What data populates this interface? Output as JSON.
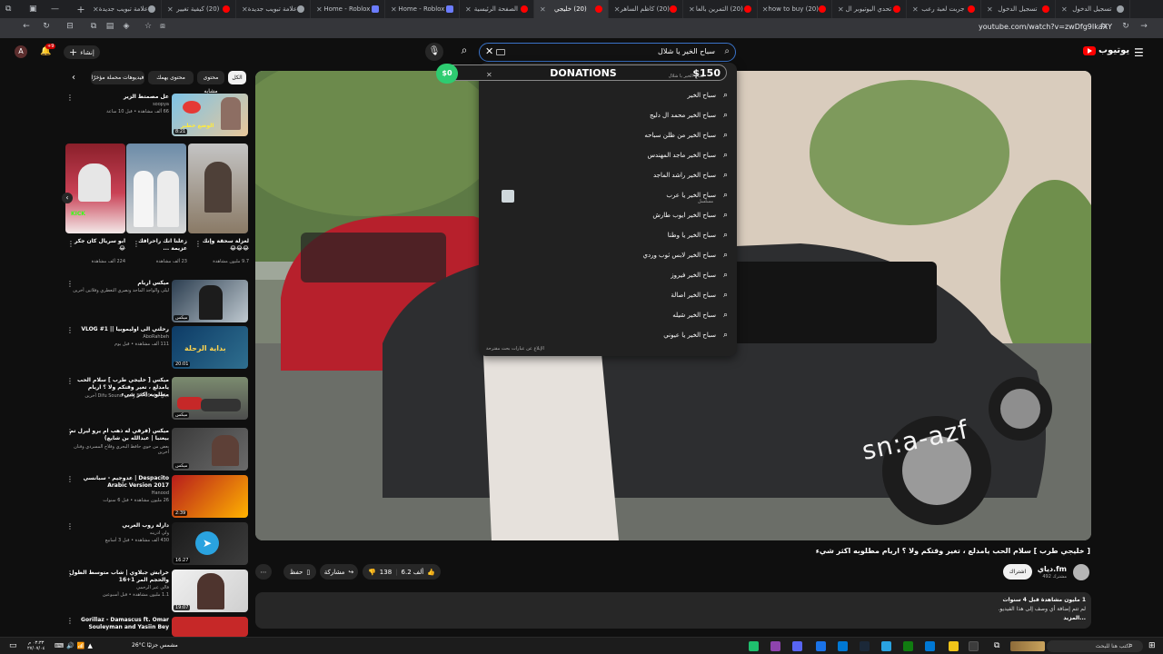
{
  "browser": {
    "tabs": [
      {
        "title": "تسجيل الدخول",
        "favicon": "profile-icon"
      },
      {
        "title": "تسجيل الدخول",
        "favicon": "youtube-icon"
      },
      {
        "title": "جربت لعبة رعب",
        "favicon": "youtube-icon"
      },
      {
        "title": "تحدي اليوتيوبر ال",
        "favicon": "youtube-icon"
      },
      {
        "title": "(20) how to buy",
        "favicon": "youtube-icon"
      },
      {
        "title": "(20) التمرين بالعا",
        "favicon": "youtube-icon"
      },
      {
        "title": "(20) كاظم الساهر",
        "favicon": "youtube-icon"
      },
      {
        "title": "(20) خليجي",
        "favicon": "youtube-icon"
      },
      {
        "title": "الصفحة الرئيسية",
        "favicon": "youtube-icon"
      },
      {
        "title": "Home - Roblox",
        "favicon": "roblox-icon"
      },
      {
        "title": "Home - Roblox",
        "favicon": "roblox-icon"
      },
      {
        "title": "علامة تبويب جديدة",
        "favicon": "chrome-icon"
      },
      {
        "title": "(20) كيفية تغيير",
        "favicon": "youtube-icon"
      },
      {
        "title": "علامة تبويب جديدة",
        "favicon": "chrome-icon"
      }
    ],
    "url": "youtube.com/watch?v=zwDfg9IkaXY"
  },
  "youtube": {
    "logo_text": "يوتيوب",
    "avatar_letter": "A",
    "bell_badge": "+9",
    "create_label": "إنشاء",
    "search_query": "سباح الخير يا شلال",
    "suggestions": [
      "سباح الخير يا شلال",
      "سباح الخير",
      "سباح الخير محمد ال دليج",
      "سباح الخير من ظلن سباحه",
      "سباح الخير ماجد المهندس",
      "سباح الخير راشد الماجد",
      "سباح الخير يا عرب",
      "سباح الخير ايوب طارش",
      "سباح الخير يا وطنا",
      "سباح الخير لابس ثوب وردي",
      "سباح الخير فيروز",
      "سباح الخير اصالة",
      "سباح الخير شيله",
      "سباح الخير يا عيوني"
    ],
    "suggestion_sub": "مسلسل",
    "report_text": "الإبلاغ عن عبارات بحث مقترحة",
    "donation": {
      "title": "DONATIONS",
      "left": "$0",
      "right": "$150"
    }
  },
  "video": {
    "watermark": "sn:a-azf",
    "title": "[ خليجي طرب ] سلام الحب يامدلع ، تغير وقتكم ولا ؟ اريام مطلوبه اكثر شيء",
    "channel": "دياي.fm",
    "subs": "492 مشترك",
    "subscribe_label": "اشتراك",
    "likes": "6.2 ألف",
    "dislikes": "138",
    "share_label": "مشاركة",
    "save_label": "حفظ",
    "desc_line1": "1 مليون مشاهدة  قبل 4 سنوات",
    "desc_line2": "لم تتم إضافة أي وصف إلى هذا الفيديو.",
    "desc_more": "...المزيد"
  },
  "sidebar": {
    "chips": [
      "الكل",
      "محتوى مشابه",
      "محتوى يهمك",
      "فيديوهات محملة مؤخرًا"
    ],
    "top_rec": {
      "title": "عل مصمتط الزير",
      "channel": "soopya",
      "views": "66 ألف مشاهدة • قبل 10 ساعة",
      "duration": "8:21",
      "thumb_text": "الوضع خطير"
    },
    "shorts": [
      {
        "title": "ابو سريال كان جكر 😂",
        "views": "224 ألف مشاهدة"
      },
      {
        "title": "زعلنا انك راحرافك عزيمة ...",
        "views": "23 ألف مشاهدة"
      },
      {
        "title": "لعزلة سحقة وإنك 😂😂😂",
        "views": "9.7 مليون مشاهدة"
      }
    ],
    "recs": [
      {
        "title": "ميكس اريام",
        "channel": "ليلى والواجد الماجد ونصري التعطري وفلاتين أخرين",
        "views": "",
        "duration": "ميكس"
      },
      {
        "title": "رحلتي الى اوليموبيا || VLOG #1",
        "channel": "AboRahbeh",
        "views": "111 ألف مشاهدة • قبل يوم",
        "duration": "20:01"
      },
      {
        "title": "ميكس [ خليجي طرب ] سلام الحب يامدلع ، تغير وقتكم ولا ؟ اريام مطلوبه اكثر شيء",
        "channel": "دياي ترك 66 FM والتين Difu Sound أخرين",
        "views": "",
        "duration": "ميكس"
      },
      {
        "title": "ميكس (فرقي له ذهب ام يرو ليرل تم بيعتبا | عبدالله بن شايع)",
        "channel": "بعض من خوي حافظ البحري وفلاح المسردي وفنان أخرين",
        "views": "",
        "duration": "ميكس"
      },
      {
        "title": "Despacito | عدوجيم - سبانسي Arabic Version 2017",
        "channel": "Hanood",
        "views": "26 مليون مشاهدة • قبل 6 سنوات",
        "duration": "2:39"
      },
      {
        "title": "دارلة روب العربي",
        "channel": "ولي ادرينه",
        "views": "430 ألف مشاهدة • قبل 3 أسابيع",
        "duration": "16:27"
      },
      {
        "title": "خرابش جبلاوي | شاب متوسط الطول والحجم المر 1+16",
        "channel": "فالي عبر الرحمي",
        "views": "1.1 مليون مشاهدة • قبل أسبوعين",
        "duration": "19:07"
      },
      {
        "title": "Gorillaz - Damascus ft. Omar Souleyman and Yasiin Bey",
        "channel": "",
        "views": "",
        "duration": ""
      }
    ]
  },
  "taskbar": {
    "search_placeholder": "اكتب هنا للبحث",
    "weather": "26°C مشمس جزئيًا",
    "time": "٠٣:٣٣ م",
    "date": "٢٧/٠٧/٠٤"
  }
}
